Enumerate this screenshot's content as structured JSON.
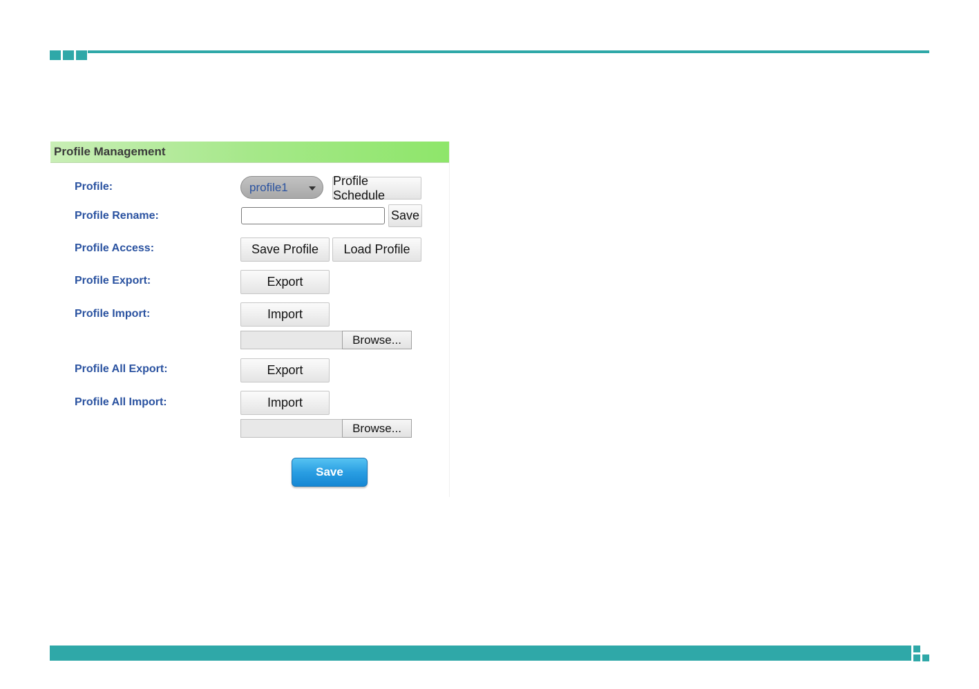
{
  "colors": {
    "accent": "#2fa8a8",
    "label": "#2a52a0",
    "header_green": "#a6e88a",
    "save_blue": "#2a9ee2"
  },
  "panel": {
    "title": "Profile Management"
  },
  "rows": {
    "profile": {
      "label": "Profile:",
      "select_value": "profile1",
      "schedule_button": "Profile Schedule"
    },
    "rename": {
      "label": "Profile Rename:",
      "input_value": "",
      "save_button": "Save"
    },
    "access": {
      "label": "Profile Access:",
      "save_profile_button": "Save Profile",
      "load_profile_button": "Load Profile"
    },
    "export": {
      "label": "Profile Export:",
      "button": "Export"
    },
    "import": {
      "label": "Profile Import:",
      "button": "Import",
      "browse_button": "Browse..."
    },
    "all_export": {
      "label": "Profile All Export:",
      "button": "Export"
    },
    "all_import": {
      "label": "Profile All Import:",
      "button": "Import",
      "browse_button": "Browse..."
    }
  },
  "footer": {
    "save_button": "Save"
  }
}
